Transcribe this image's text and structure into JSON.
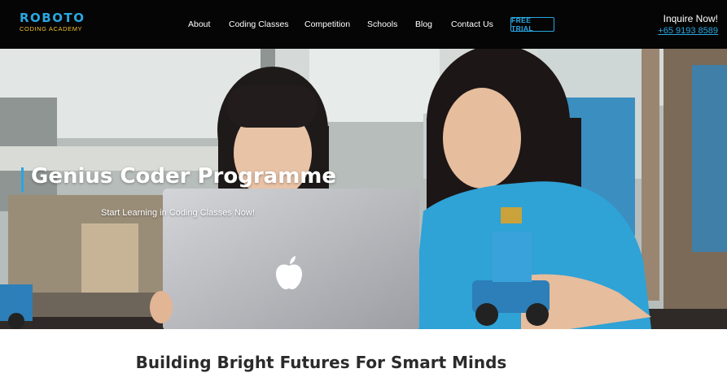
{
  "header": {
    "logo": {
      "main": "ROBOTO",
      "sub": "CODING ACADEMY"
    },
    "nav": [
      {
        "label": "About"
      },
      {
        "label": "Coding Classes"
      },
      {
        "label": "Competition"
      },
      {
        "label": "Schools"
      },
      {
        "label": "Blog"
      },
      {
        "label": "Contact Us"
      }
    ],
    "cta_label": "FREE TRIAL",
    "inquire": {
      "title": "Inquire Now!",
      "phone": "+65 9193 8589"
    }
  },
  "hero": {
    "title": "Genius Coder Programme",
    "subtitle": "Start Learning in Coding Classes Now!",
    "laptop_brand_icon": "apple-logo-icon",
    "accent_color": "#29a7e1"
  },
  "main": {
    "heading": "Building Bright Futures For Smart Minds"
  },
  "colors": {
    "header_bg": "#050505",
    "brand_blue": "#29a7e1",
    "brand_yellow": "#f2c230"
  }
}
